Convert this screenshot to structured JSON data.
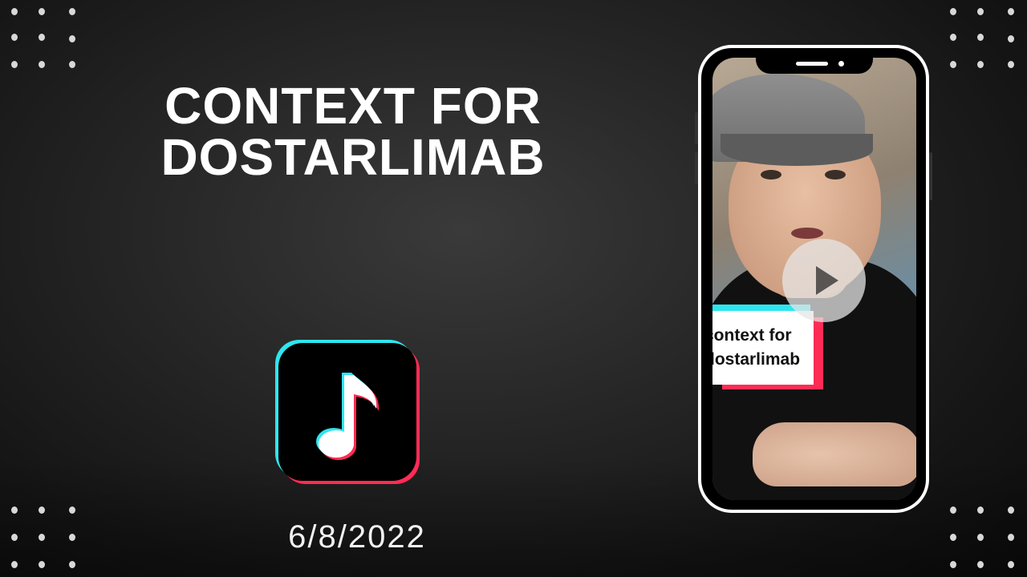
{
  "slide": {
    "title_line1": "CONTEXT FOR",
    "title_line2": "DOSTARLIMAB",
    "date": "6/8/2022"
  },
  "app_icon": {
    "name": "tiktok-note-icon",
    "colors": {
      "cyan": "#2ee6ef",
      "red": "#fe2c55",
      "background": "#000000"
    }
  },
  "phone": {
    "video": {
      "caption_line1": "context for",
      "caption_line2": "dostarlimab",
      "play_icon": "play-icon"
    }
  },
  "decorations": {
    "dot_clusters": [
      "top-left",
      "top-right",
      "bottom-left",
      "bottom-right"
    ]
  }
}
